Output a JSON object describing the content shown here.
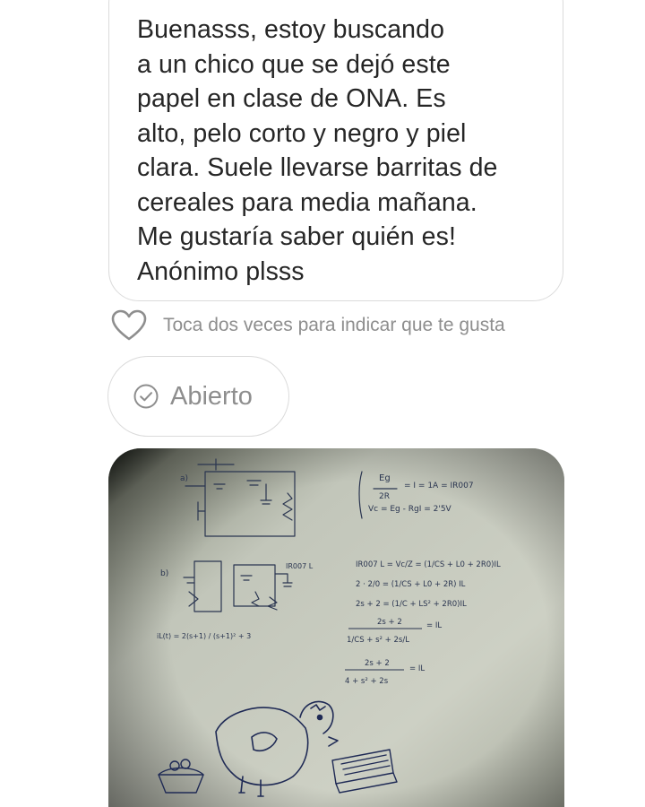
{
  "message": {
    "text": "Buenasss, estoy buscando\na un chico que se dejó este\npapel en clase de ONA. Es\nalto, pelo corto y negro y piel\nclara. Suele llevarse barritas de\ncereales para media mañana.\nMe gustaría saber quién es!\nAnónimo plsss"
  },
  "like": {
    "icon": "heart-outline-icon",
    "hint": "Toca dos veces para indicar que te gusta"
  },
  "status": {
    "icon": "check-circle-icon",
    "label": "Abierto"
  },
  "photo": {
    "subject": "handwritten-circuit-notes-with-bird-doodle",
    "notes": {
      "ec1": "Eg",
      "ec2": "2R",
      "ec3": "= I = 1A = IR007",
      "ec4": "Vc = Eg - RgI = 2'5V",
      "ec5": "IR007 L = Vc/Z = (1/CS + L0 + 2R0)IL",
      "ec6": "2 · 2/0 = (1/CS + L0 + 2R) IL",
      "ec7": "2s + 2 = (1/C + LS² + 2R0)IL",
      "ec8": "2s + 2",
      "ec9": "1/CS + s² + 2s/L",
      "ec10": "= IL",
      "ec11": "2s + 2",
      "ec12": "4 + s² + 2s",
      "ec13": "= IL",
      "ec14": "iL(t) = 2(s+1) / (s+1)² + 3",
      "lbl_a": "a)",
      "lbl_b": "b)",
      "lbl_ir": "IR007 L"
    },
    "colors": {
      "paper": "#c6cabe",
      "ink": "#2a3550"
    }
  }
}
